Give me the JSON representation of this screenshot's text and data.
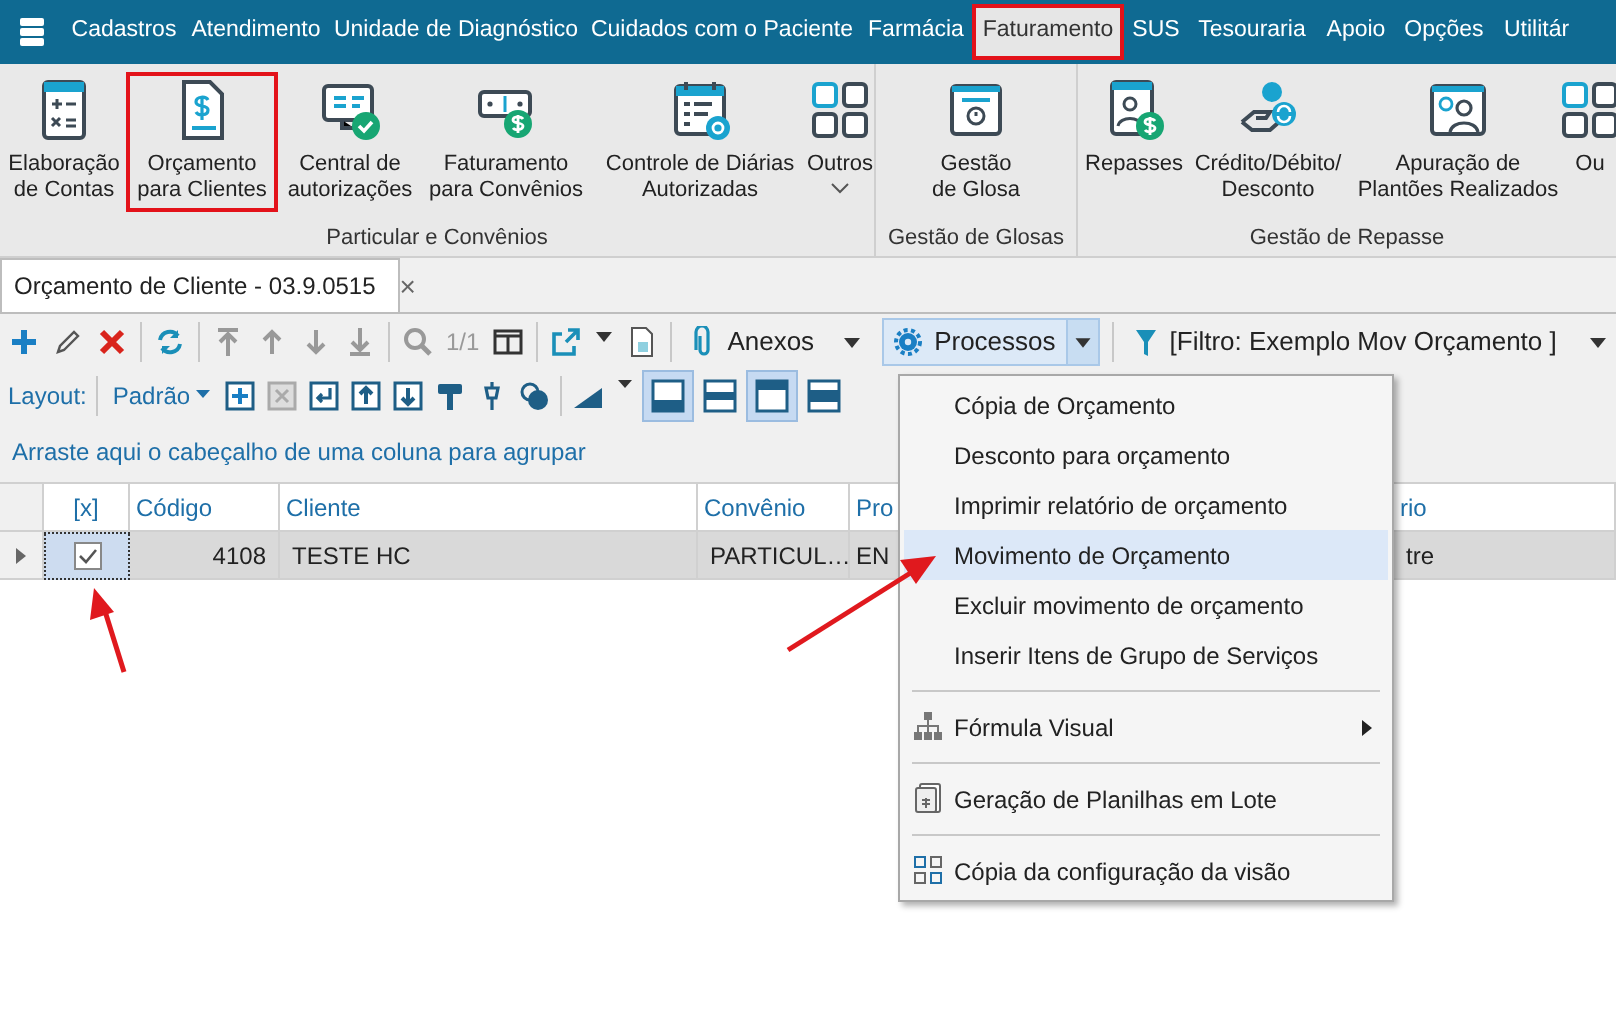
{
  "menu_bar": {
    "items": [
      {
        "label": "Cadastros",
        "selected": false
      },
      {
        "label": "Atendimento",
        "selected": false
      },
      {
        "label": "Unidade de Diagnóstico",
        "selected": false
      },
      {
        "label": "Cuidados com o Paciente",
        "selected": false
      },
      {
        "label": "Farmácia",
        "selected": false
      },
      {
        "label": "Faturamento",
        "selected": true
      },
      {
        "label": "SUS",
        "selected": false
      },
      {
        "label": "Tesouraria",
        "selected": false
      },
      {
        "label": "Apoio",
        "selected": false
      },
      {
        "label": "Opções",
        "selected": false
      },
      {
        "label": "Utilitár",
        "selected": false
      }
    ]
  },
  "ribbon": {
    "groups": [
      {
        "label": "Particular e Convênios",
        "items": [
          {
            "label": "Elaboração\nde Contas",
            "highlighted": false,
            "dropdown": false
          },
          {
            "label": "Orçamento\npara Clientes",
            "highlighted": true,
            "dropdown": false
          },
          {
            "label": "Central de\nautorizações",
            "highlighted": false,
            "dropdown": false
          },
          {
            "label": "Faturamento\npara Convênios",
            "highlighted": false,
            "dropdown": false
          },
          {
            "label": "Controle de Diárias\nAutorizadas",
            "highlighted": false,
            "dropdown": false
          },
          {
            "label": "Outros",
            "highlighted": false,
            "dropdown": true
          }
        ]
      },
      {
        "label": "Gestão de Glosas",
        "items": [
          {
            "label": "Gestão\nde Glosa",
            "highlighted": false,
            "dropdown": false
          }
        ]
      },
      {
        "label": "Gestão de Repasse",
        "items": [
          {
            "label": "Repasses",
            "highlighted": false,
            "dropdown": false
          },
          {
            "label": "Crédito/Débito/\nDesconto",
            "highlighted": false,
            "dropdown": false
          },
          {
            "label": "Apuração de\nPlantões Realizados",
            "highlighted": false,
            "dropdown": false
          },
          {
            "label": "Ou",
            "highlighted": false,
            "dropdown": false
          }
        ]
      }
    ]
  },
  "document_tab": {
    "title": "Orçamento de Cliente - 03.9.0515",
    "close": "×"
  },
  "toolbar": {
    "page": "1/1",
    "anexos": "Anexos",
    "processos": "Processos",
    "filter": "[Filtro: Exemplo Mov Orçamento ]"
  },
  "layout_bar": {
    "label": "Layout:",
    "layout": "Padrão",
    "toggles": [
      true,
      false,
      true,
      false
    ]
  },
  "group_panel": {
    "hint": "Arraste aqui o cabeçalho de uma coluna para agrupar"
  },
  "table": {
    "checkbox_header": "[x]",
    "columns": [
      "Código",
      "Cliente",
      "Convênio",
      "Pro",
      "rio"
    ],
    "rows": [
      {
        "checked": true,
        "selected": true,
        "cells": [
          "4108",
          "TESTE HC",
          "PARTICUL…",
          "EN",
          "tre"
        ]
      }
    ]
  },
  "processos_menu": {
    "groups": [
      [
        {
          "label": "Cópia de Orçamento",
          "selected": false,
          "submenu": false
        },
        {
          "label": "Desconto para orçamento",
          "selected": false,
          "submenu": false
        },
        {
          "label": "Imprimir relatório de orçamento",
          "selected": false,
          "submenu": false
        },
        {
          "label": "Movimento de Orçamento",
          "selected": true,
          "submenu": false
        },
        {
          "label": "Excluir movimento de orçamento",
          "selected": false,
          "submenu": false
        },
        {
          "label": "Inserir Itens de Grupo de Serviços",
          "selected": false,
          "submenu": false
        }
      ],
      [
        {
          "label": "Fórmula Visual",
          "selected": false,
          "submenu": true
        }
      ],
      [
        {
          "label": "Geração de Planilhas em Lote",
          "selected": false,
          "submenu": false
        }
      ],
      [
        {
          "label": "Cópia da configuração da visão",
          "selected": false,
          "submenu": false
        }
      ]
    ]
  }
}
